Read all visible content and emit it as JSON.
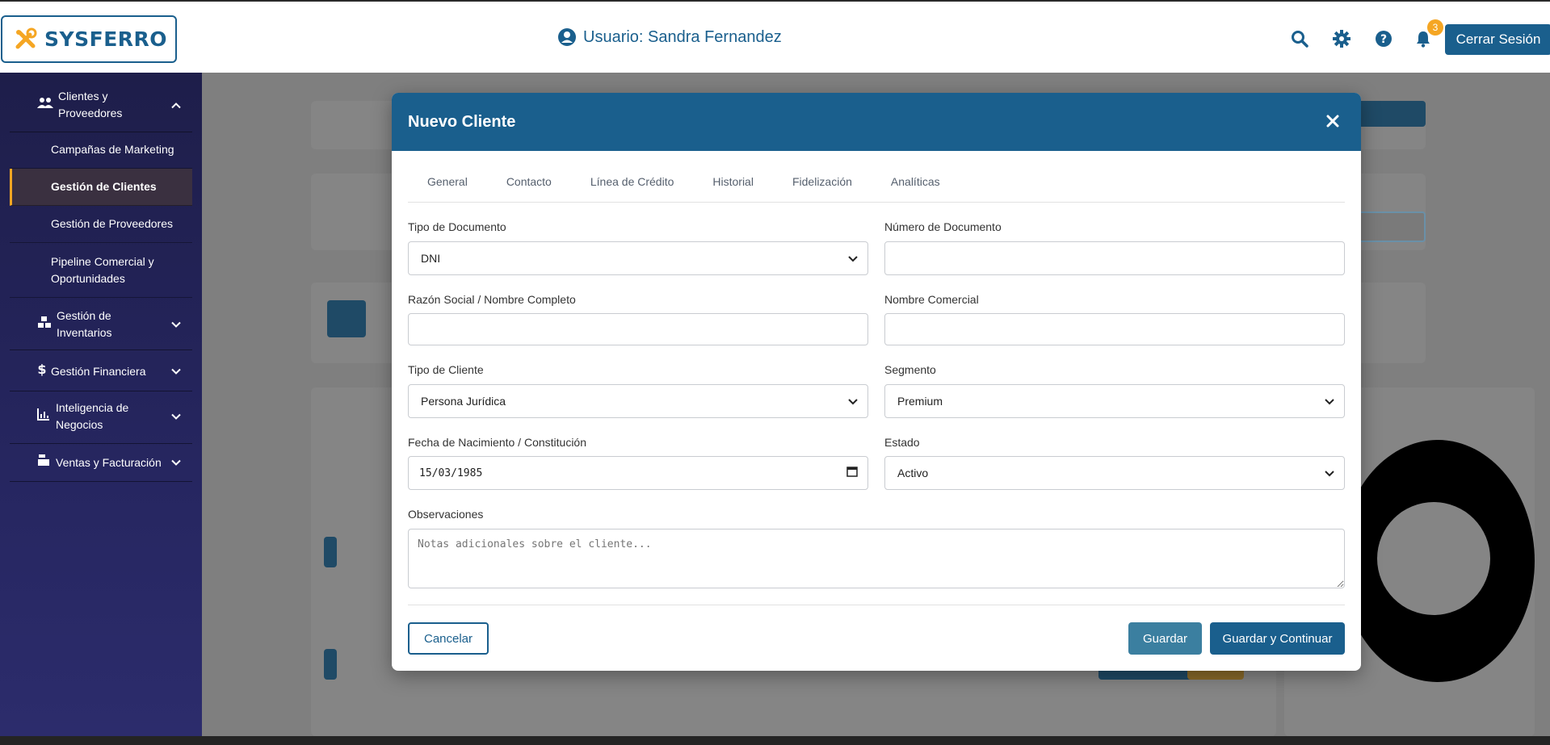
{
  "header": {
    "brand": "SYSFERRO",
    "user_label": "Usuario: Sandra Fernandez",
    "notification_count": "3",
    "logout_label": "Cerrar Sesión"
  },
  "sidebar": {
    "groups": [
      {
        "label": "Clientes y Proveedores",
        "expanded": true
      },
      {
        "label": "Gestión de Inventarios",
        "expanded": false
      },
      {
        "label": "Gestión Financiera",
        "expanded": false
      },
      {
        "label": "Inteligencia de Negocios",
        "expanded": false
      },
      {
        "label": "Ventas y Facturación",
        "expanded": false
      }
    ],
    "subitems": [
      {
        "label": "Campañas de Marketing"
      },
      {
        "label": "Gestión de Clientes",
        "active": true
      },
      {
        "label": "Gestión de Proveedores"
      },
      {
        "label": "Pipeline Comercial y Oportunidades"
      }
    ]
  },
  "modal": {
    "title": "Nuevo Cliente",
    "tabs": [
      "General",
      "Contacto",
      "Línea de Crédito",
      "Historial",
      "Fidelización",
      "Analíticas"
    ],
    "fields": {
      "doc_type": {
        "label": "Tipo de Documento",
        "value": "DNI"
      },
      "doc_number": {
        "label": "Número de Documento",
        "value": ""
      },
      "legal_name": {
        "label": "Razón Social / Nombre Completo",
        "value": ""
      },
      "trade_name": {
        "label": "Nombre Comercial",
        "value": ""
      },
      "client_type": {
        "label": "Tipo de Cliente",
        "value": "Persona Jurídica"
      },
      "segment": {
        "label": "Segmento",
        "value": "Premium"
      },
      "birth_date": {
        "label": "Fecha de Nacimiento / Constitución",
        "value": "15/03/1985"
      },
      "status": {
        "label": "Estado",
        "value": "Activo"
      },
      "notes": {
        "label": "Observaciones",
        "placeholder": "Notas adicionales sobre el cliente..."
      }
    },
    "buttons": {
      "cancel": "Cancelar",
      "save": "Guardar",
      "save_continue": "Guardar y Continuar"
    }
  },
  "colors": {
    "primary": "#1a5f8d",
    "accent": "#f5a623",
    "sidebar": "#262660"
  }
}
